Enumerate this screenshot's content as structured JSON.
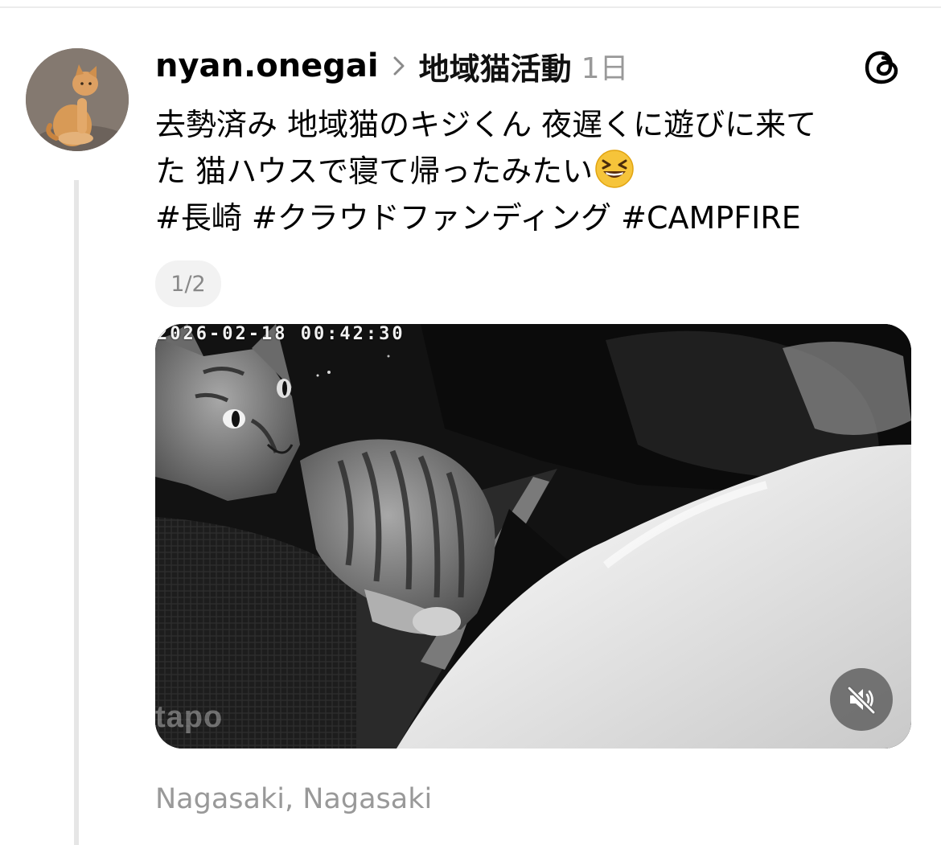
{
  "post": {
    "username": "nyan.onegai",
    "topic": "地域猫活動",
    "time": "1日",
    "caption_line1": "去勢済み 地域猫のキジくん 夜遅くに遊びに来て",
    "caption_line2": "た 猫ハウスで寝て帰ったみたい",
    "hashtags": "#長崎 #クラウドファンディング #CAMPFIRE",
    "media_counter": "1/2",
    "location": "Nagasaki, Nagasaki"
  },
  "media": {
    "timestamp": "2026-02-18 00:42:30",
    "watermark": "tapo",
    "mute_icon": "speaker-muted-icon"
  },
  "icons": {
    "avatar": "orange-cat-photo",
    "brand": "threads-logo-icon",
    "chevron": "chevron-right-icon",
    "emoji": "grinning-squinting-face-emoji"
  },
  "colors": {
    "text": "#000000",
    "secondary_text": "#999999",
    "thread_line": "#e6e6e6",
    "counter_bg": "#f2f2f2",
    "mute_bg": "#696969"
  }
}
